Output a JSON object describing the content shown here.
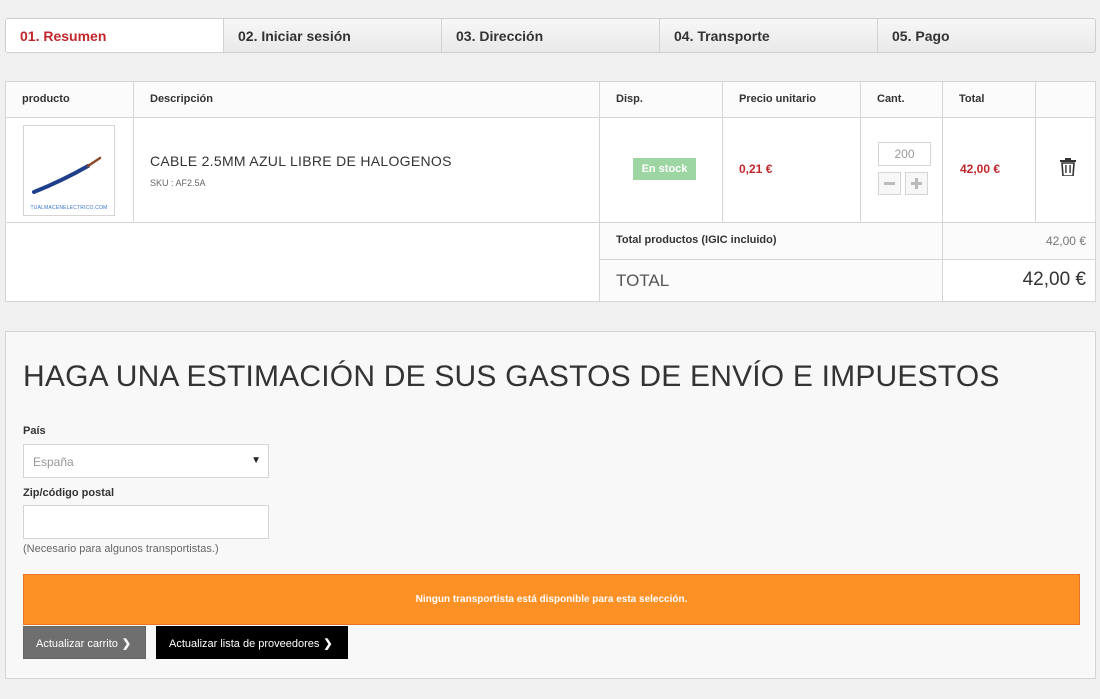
{
  "steps": [
    "01. Resumen",
    "02. Iniciar sesión",
    "03. Dirección",
    "04. Transporte",
    "05. Pago"
  ],
  "cart": {
    "headers": {
      "product": "producto",
      "description": "Descripción",
      "availability": "Disp.",
      "unit_price": "Precio unitario",
      "qty": "Cant.",
      "total": "Total"
    },
    "item": {
      "thumb_text": "TUALMACENELECTRICO.COM",
      "name": "CABLE 2.5MM AZUL LIBRE DE HALOGENOS",
      "sku": "SKU : AF2.5A",
      "availability": "En stock",
      "unit_price": "0,21 €",
      "quantity": "200",
      "total": "42,00 €"
    },
    "subtotal_label": "Total productos (IGIC incluido)",
    "subtotal_value": "42,00 €",
    "total_label": "TOTAL",
    "total_value": "42,00 €"
  },
  "estimate": {
    "title": "HAGA UNA ESTIMACIÓN DE SUS GASTOS DE ENVÍO E IMPUESTOS",
    "country_label": "País",
    "country_value": "España",
    "zip_label": "Zip/código postal",
    "zip_value": "",
    "zip_hint": "(Necesario para algunos transportistas.)",
    "alert": "Ningun transportista está disponible para esta selección.",
    "update_cart_btn": "Actualizar carrito",
    "update_providers_btn": "Actualizar lista de proveedores"
  },
  "icons": [
    "trash-icon",
    "chevron-right-icon",
    "caret-down-icon"
  ],
  "colors": {
    "accent": "#c1272d",
    "stock": "#9dd5a3",
    "alert": "#fe9126"
  }
}
